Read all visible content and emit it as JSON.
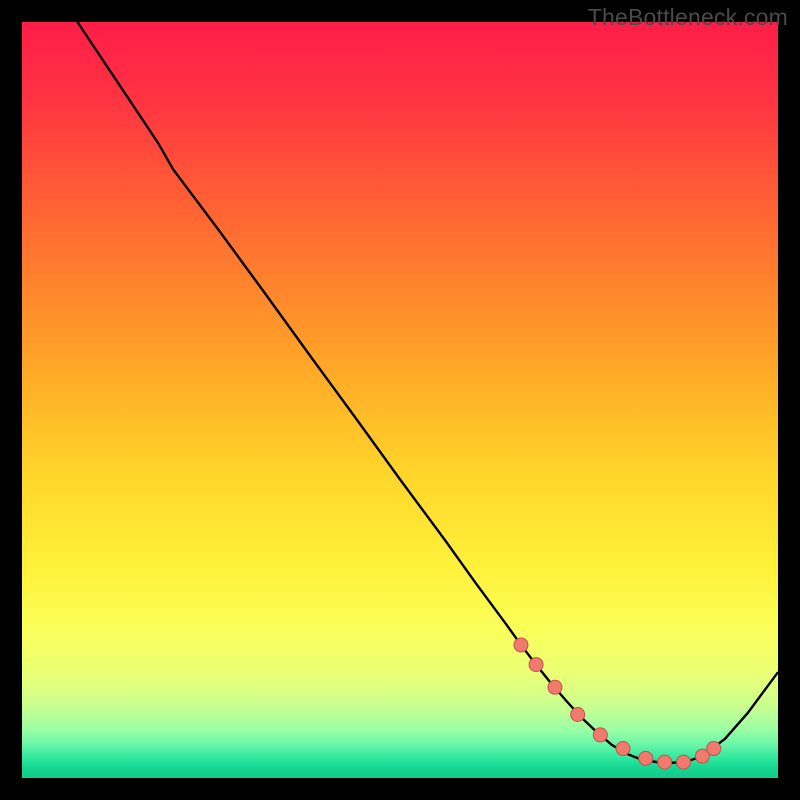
{
  "watermark": "TheBottleneck.com",
  "colors": {
    "frame": "#000000",
    "stroke": "#000000",
    "marker_fill": "#f07a6d",
    "marker_stroke": "#c0544a",
    "gradient_stops": [
      {
        "offset": 0.0,
        "color": "#ff1d49"
      },
      {
        "offset": 0.1,
        "color": "#ff3342"
      },
      {
        "offset": 0.22,
        "color": "#ff5a36"
      },
      {
        "offset": 0.35,
        "color": "#ff842c"
      },
      {
        "offset": 0.48,
        "color": "#ffaf27"
      },
      {
        "offset": 0.6,
        "color": "#ffd62a"
      },
      {
        "offset": 0.72,
        "color": "#fff13a"
      },
      {
        "offset": 0.8,
        "color": "#fbff58"
      },
      {
        "offset": 0.865,
        "color": "#e9ff77"
      },
      {
        "offset": 0.905,
        "color": "#c9ff90"
      },
      {
        "offset": 0.935,
        "color": "#9dffa3"
      },
      {
        "offset": 0.955,
        "color": "#6cf7a8"
      },
      {
        "offset": 0.972,
        "color": "#34eaa0"
      },
      {
        "offset": 0.985,
        "color": "#16d894"
      },
      {
        "offset": 1.0,
        "color": "#13c98b"
      }
    ]
  },
  "chart_data": {
    "type": "line",
    "title": "",
    "xlabel": "",
    "ylabel": "",
    "xlim": [
      0,
      100
    ],
    "ylim": [
      0,
      100
    ],
    "grid": false,
    "series": [
      {
        "name": "curve",
        "x": [
          0,
          6,
          12,
          18,
          20,
          26,
          32,
          38,
          44,
          50,
          56,
          60,
          64,
          66,
          68,
          70,
          72,
          74,
          76,
          78,
          80,
          82,
          84,
          86,
          88,
          90,
          93,
          96,
          100
        ],
        "y": [
          110,
          102,
          93,
          84,
          80.5,
          72.5,
          64.3,
          56,
          47.8,
          39.5,
          31.4,
          25.8,
          20.4,
          17.6,
          15.0,
          12.5,
          10.2,
          8.0,
          6.1,
          4.4,
          3.2,
          2.4,
          2.1,
          2.0,
          2.2,
          2.9,
          5.2,
          8.6,
          14.0
        ]
      }
    ],
    "markers": {
      "name": "highlight-points",
      "x": [
        66.0,
        68.0,
        70.5,
        73.5,
        76.5,
        79.5,
        82.5,
        85.0,
        87.5,
        90.0,
        91.5
      ],
      "y": [
        17.6,
        15.0,
        12.0,
        8.4,
        5.7,
        3.9,
        2.6,
        2.1,
        2.1,
        2.9,
        3.9
      ]
    }
  }
}
